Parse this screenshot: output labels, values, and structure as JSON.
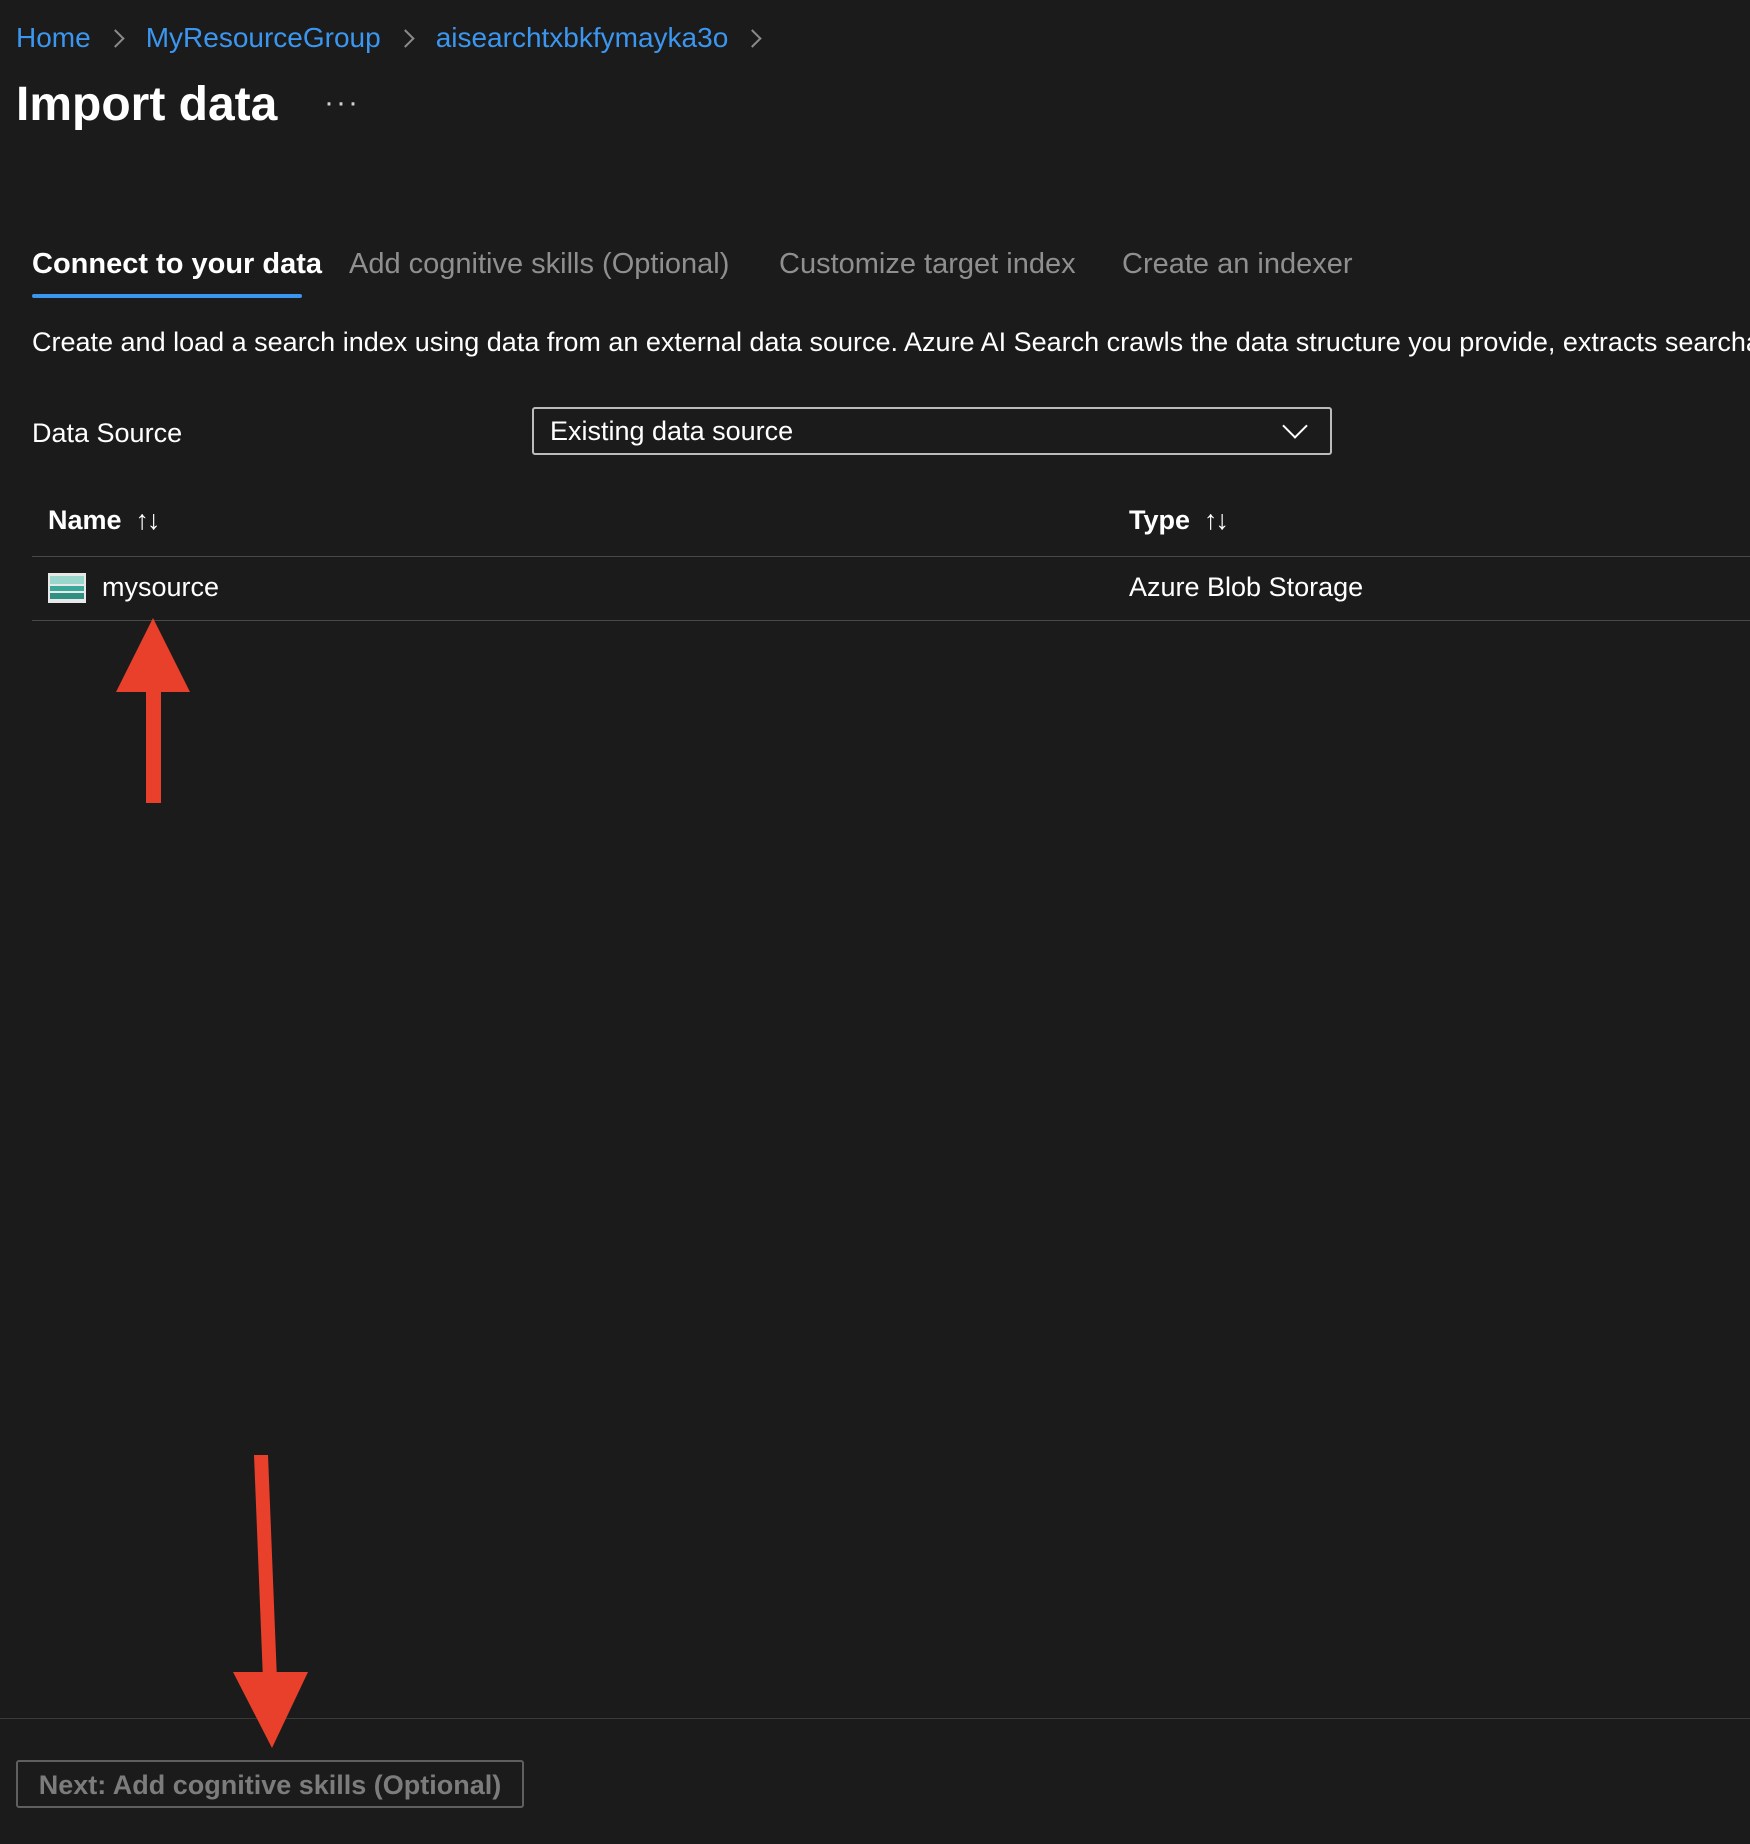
{
  "breadcrumb": {
    "items": [
      "Home",
      "MyResourceGroup",
      "aisearchtxbkfymayka3o"
    ]
  },
  "page": {
    "title": "Import data",
    "more_label": "···"
  },
  "tabs": [
    {
      "label": "Connect to your data",
      "active": true
    },
    {
      "label": "Add cognitive skills (Optional)",
      "active": false
    },
    {
      "label": "Customize target index",
      "active": false
    },
    {
      "label": "Create an indexer",
      "active": false
    }
  ],
  "description": "Create and load a search index using data from an external data source. Azure AI Search crawls the data structure you provide, extracts searchable con",
  "data_source": {
    "label": "Data Source",
    "selected": "Existing data source"
  },
  "table": {
    "columns": [
      {
        "label": "Name",
        "sort_icon": "↑↓"
      },
      {
        "label": "Type",
        "sort_icon": "↑↓"
      }
    ],
    "rows": [
      {
        "icon": "blob-storage-icon",
        "name": "mysource",
        "type": "Azure Blob Storage"
      }
    ]
  },
  "footer": {
    "next_label": "Next: Add cognitive skills (Optional)"
  },
  "colors": {
    "background": "#1b1b1b",
    "link": "#3b96f0",
    "annotation_arrow": "#e8402a"
  }
}
